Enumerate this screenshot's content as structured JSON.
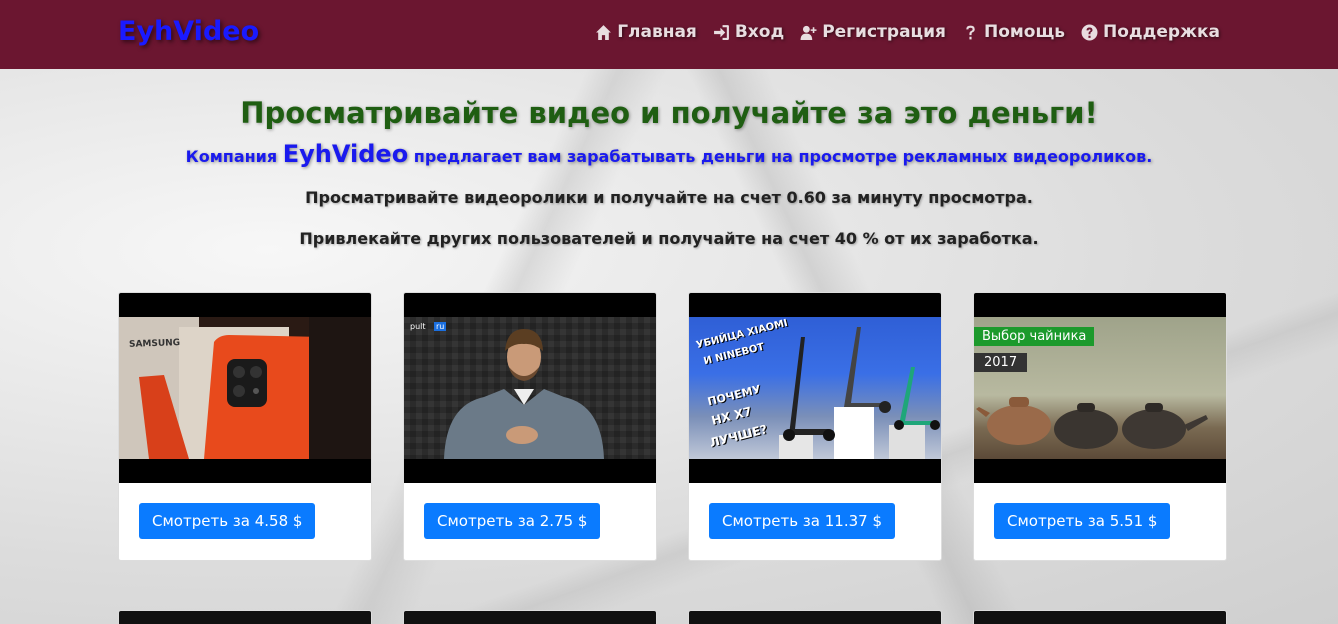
{
  "brand": "EyhVideo",
  "nav": [
    {
      "icon": "home-icon",
      "label": "Главная"
    },
    {
      "icon": "login-icon",
      "label": "Вход"
    },
    {
      "icon": "user-plus-icon",
      "label": "Регистрация"
    },
    {
      "icon": "question-icon",
      "label": "Помощь"
    },
    {
      "icon": "question-circle-icon",
      "label": "Поддержка"
    }
  ],
  "hero": {
    "headline": "Просматривайте видео и получайте за это деньги!",
    "sub_prefix": "Компания",
    "sub_brand": "EyhVideo",
    "sub_suffix": "предлагает вам зарабатывать деньги на просмотре рекламных видеороликов.",
    "line1": "Просматривайте видеоролики и получайте на счет 0.60 за минуту просмотра.",
    "line2": "Привлекайте других пользователей и получайте на счет 40 % от их заработка."
  },
  "videos": [
    {
      "button": "Смотреть за 4.58 $",
      "thumb_text": [
        "SAMSUNG"
      ]
    },
    {
      "button": "Смотреть за 2.75 $",
      "thumb_text": [
        "pult",
        "ru"
      ]
    },
    {
      "button": "Смотреть за 11.37 $",
      "thumb_text": [
        "УБИЙЦА XIAOMI",
        "И NINEBOT",
        "ПОЧЕМУ",
        "HX X7",
        "ЛУЧШЕ?"
      ]
    },
    {
      "button": "Смотреть за 5.51 $",
      "thumb_text": [
        "Выбор чайника",
        "2017"
      ]
    }
  ],
  "colors": {
    "navbar": "#6b1630",
    "brand": "#1a1aff",
    "headline": "#1f5e12",
    "sub": "#1a1aee",
    "button": "#0a7bff"
  }
}
